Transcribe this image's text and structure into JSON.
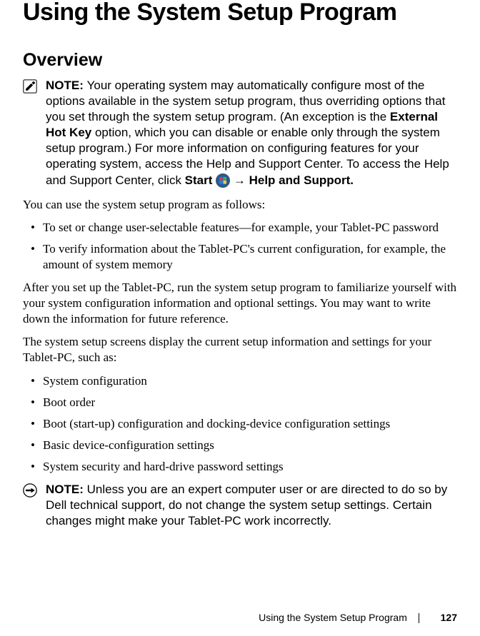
{
  "title": "Using the System Setup Program",
  "overview_heading": "Overview",
  "note1": {
    "label": "NOTE: ",
    "part1": "Your operating system may automatically configure most of the options available in the system setup program, thus overriding options that you set through the system setup program. (An exception is the ",
    "bold1": "External Hot Key",
    "part2": " option, which you can disable or enable only through the system setup program.) For more information on configuring features for your operating system, access the Help and Support Center. To access the Help and Support Center, click ",
    "bold2": "Start",
    "arrow": " → ",
    "bold3": "Help and Support."
  },
  "intro": "You can use the system setup program as follows:",
  "uses": [
    "To set or change user-selectable features—for example, your Tablet-PC password",
    "To verify information about the Tablet-PC's current configuration, for example, the amount of system memory"
  ],
  "after_setup": "After you set up the Tablet-PC, run the system setup program to familiarize yourself with your system configuration information and optional settings. You may want to write down the information for future reference.",
  "screens_intro": "The system setup screens display the current setup information and settings for your Tablet-PC, such as:",
  "screens_list": [
    "System configuration",
    "Boot order",
    "Boot (start-up) configuration and docking-device configuration settings",
    "Basic device-configuration settings",
    "System security and hard-drive password settings"
  ],
  "note2": {
    "label": "NOTE: ",
    "text": "Unless you are an expert computer user or are directed to do so by Dell technical support, do not change the system setup settings. Certain changes might make your Tablet-PC work incorrectly."
  },
  "footer": {
    "section": "Using the System Setup Program",
    "page": "127"
  }
}
